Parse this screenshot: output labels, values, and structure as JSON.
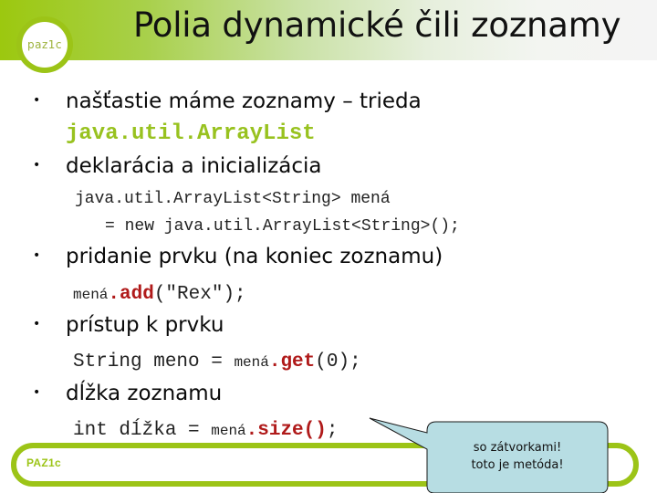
{
  "slide": {
    "logo_text": "paz1c",
    "title": "Polia dynamické čili zoznamy",
    "bullets": [
      {
        "text": "našťastie máme zoznamy – trieda"
      },
      {
        "text": "deklarácia a inicializácia"
      },
      {
        "text": "pridanie prvku (na koniec zoznamu)"
      },
      {
        "text": "prístup k prvku"
      },
      {
        "text": "dĺžka zoznamu"
      }
    ],
    "bullet_glyph": "•",
    "class_name": "java.util.ArrayList",
    "code": {
      "decl_line1": "java.util.ArrayList<String> mená",
      "decl_line2": "= new java.util.ArrayList<String>();",
      "add_var": "mená",
      "add_method": ".add",
      "add_args": "(\"Rex\");",
      "get_prefix": "String meno = ",
      "get_var": "mená",
      "get_method": ".get",
      "get_args": "(0);",
      "size_prefix": "int dĺžka = ",
      "size_var": "mená",
      "size_method": ".size()",
      "size_suffix": ";"
    },
    "callout": {
      "line1": "so zátvorkami!",
      "line2": "toto je metóda!"
    },
    "footer_text": "PAZ1c",
    "colors": {
      "accent_green": "#9cc417",
      "method_red": "#b01a1a",
      "callout_fill": "#b7dde3"
    }
  }
}
